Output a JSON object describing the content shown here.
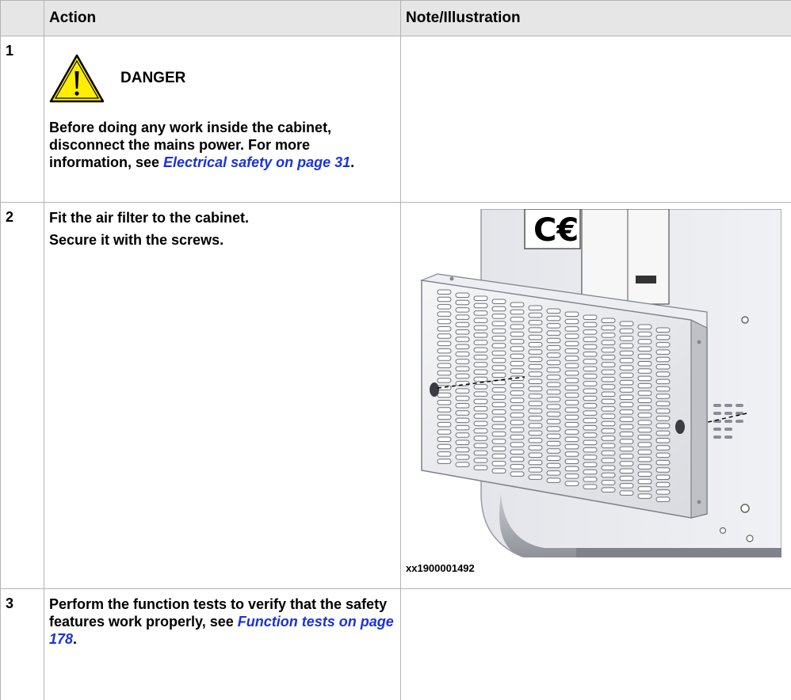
{
  "table": {
    "headers": [
      "",
      "Action",
      "Note/Illustration"
    ],
    "rows": [
      {
        "num": "1",
        "danger_label": "DANGER",
        "text_before_link": "Before doing any work inside the cabinet, disconnect the mains power. For more information, see ",
        "link_text": "Electrical safety on page 31",
        "text_after_link": "."
      },
      {
        "num": "2",
        "lines": [
          "Fit the air filter to the cabinet.",
          "Secure it with the screws."
        ],
        "illustration": {
          "icon": "ce-mark",
          "caption": "xx1900001492"
        }
      },
      {
        "num": "3",
        "text_before_link": "Perform the function tests to verify that the safety features work properly, see ",
        "link_text": "Function tests on page 178",
        "text_after_link": "."
      }
    ]
  },
  "colors": {
    "header_bg": "#e6e6e6",
    "border": "#b3b3b3",
    "link": "#1a33d6",
    "warning_yellow": "#ffee00"
  }
}
